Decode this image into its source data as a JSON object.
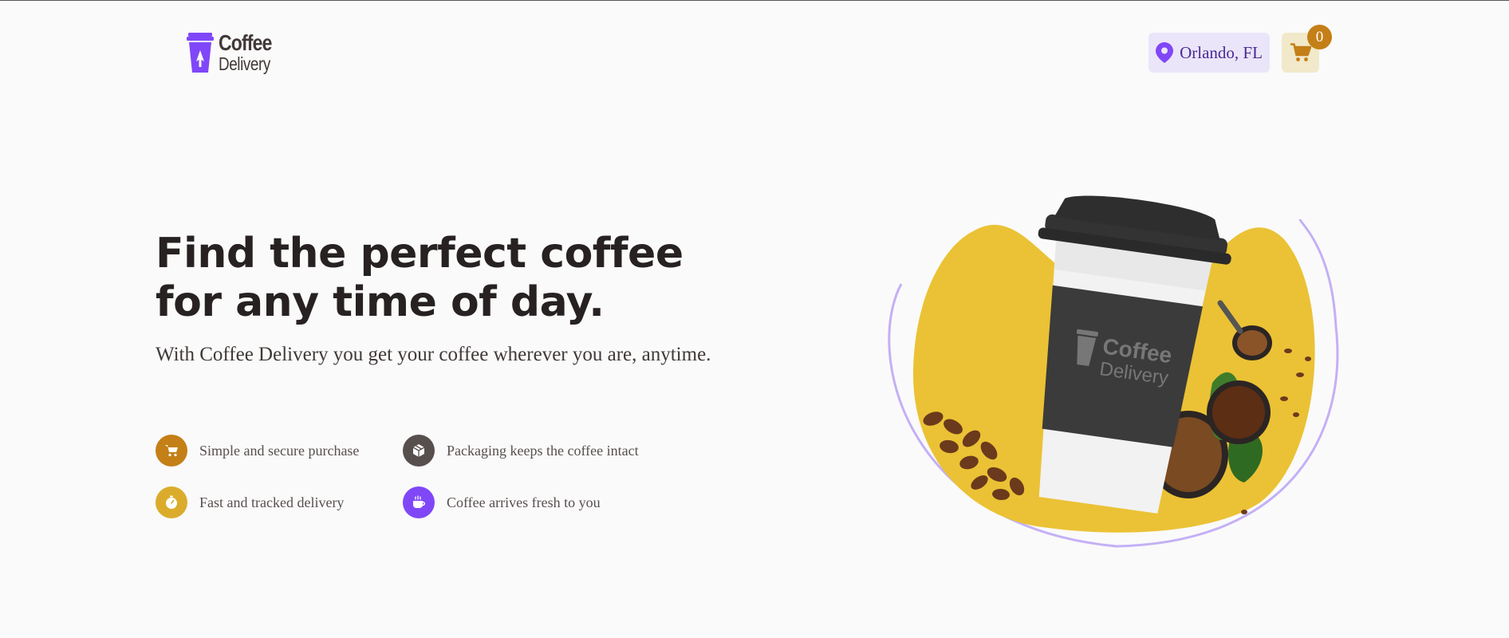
{
  "header": {
    "logo": {
      "line1": "Coffee",
      "line2": "Delivery"
    },
    "location": {
      "text": "Orlando, FL"
    },
    "cart": {
      "count": "0"
    }
  },
  "hero": {
    "title_line1": "Find the perfect coffee",
    "title_line2": "for any time of day.",
    "subtitle": "With Coffee Delivery you get your coffee wherever you are, anytime.",
    "features": [
      {
        "label": "Simple and secure purchase",
        "icon": "cart-icon",
        "color": "#c47f17"
      },
      {
        "label": "Packaging keeps the coffee intact",
        "icon": "package-icon",
        "color": "#574f4d"
      },
      {
        "label": "Fast and tracked delivery",
        "icon": "timer-icon",
        "color": "#dbac2c"
      },
      {
        "label": "Coffee arrives fresh to you",
        "icon": "coffee-icon",
        "color": "#8047f8"
      }
    ],
    "image": {
      "cup_logo_line1": "Coffee",
      "cup_logo_line2": "Delivery",
      "blob_color": "#ebc235",
      "ring_color": "#c4b0f5"
    }
  },
  "colors": {
    "purple": "#8047f8",
    "purple_dark": "#4b2995",
    "purple_light": "#ebe5f9",
    "yellow_dark": "#c47f17",
    "yellow_light": "#f1e9c9",
    "background": "#fafafa"
  }
}
